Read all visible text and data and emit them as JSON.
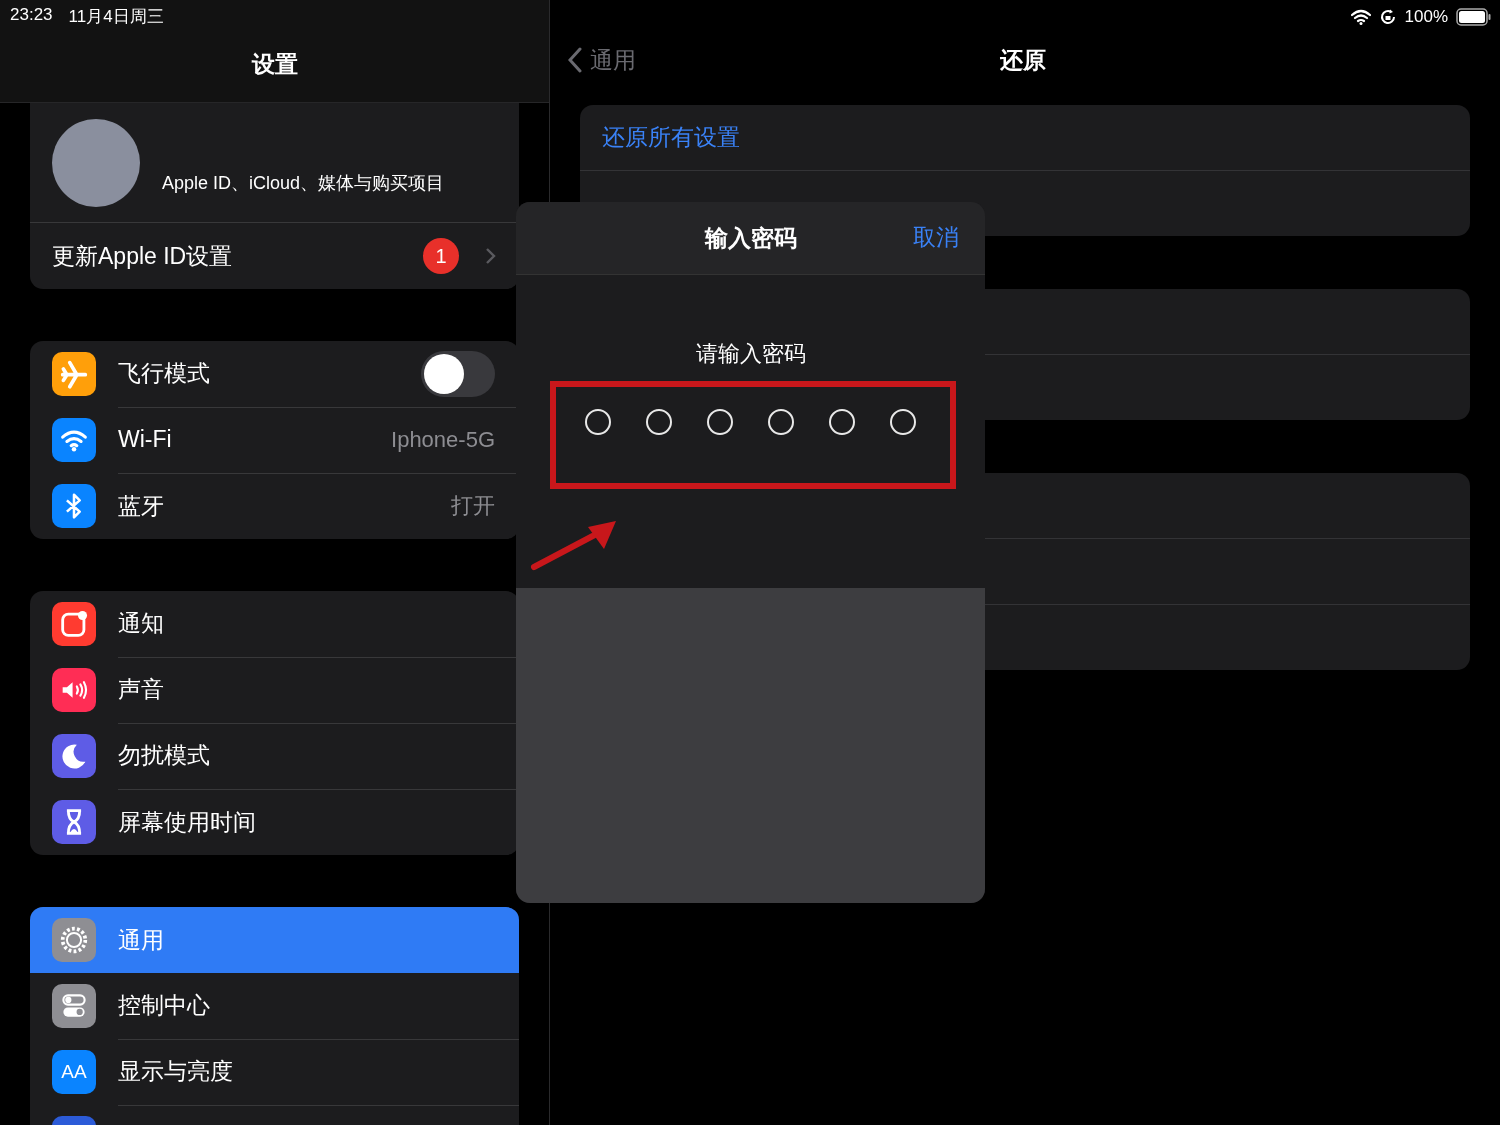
{
  "status_bar": {
    "time": "23:23",
    "date": "11月4日周三",
    "battery": "100%"
  },
  "sidebar": {
    "title": "设置",
    "profile": {
      "subtitle": "Apple ID、iCloud、媒体与购买项目",
      "update_label": "更新Apple ID设置",
      "badge": "1"
    },
    "groups": [
      {
        "items": [
          {
            "kind": "toggle",
            "color": "#ff9f0a",
            "label": "飞行模式",
            "on": false,
            "selected": false
          },
          {
            "kind": "value",
            "color": "#0a84ff",
            "label": "Wi-Fi",
            "value": "Iphone-5G",
            "selected": false
          },
          {
            "kind": "value",
            "color": "#0a84ff",
            "label": "蓝牙",
            "value": "打开",
            "selected": false
          }
        ]
      },
      {
        "items": [
          {
            "kind": "plain",
            "color": "#ff3b30",
            "label": "通知",
            "selected": false
          },
          {
            "kind": "plain",
            "color": "#ff2d55",
            "label": "声音",
            "selected": false
          },
          {
            "kind": "plain",
            "color": "#5e5ce6",
            "label": "勿扰模式",
            "selected": false
          },
          {
            "kind": "plain",
            "color": "#5e5ce6",
            "label": "屏幕使用时间",
            "selected": false
          }
        ]
      },
      {
        "items": [
          {
            "kind": "plain",
            "color": "#8e8e93",
            "label": "通用",
            "selected": true
          },
          {
            "kind": "plain",
            "color": "#8e8e93",
            "label": "控制中心",
            "selected": false
          },
          {
            "kind": "plain",
            "icon_text": "AA",
            "color": "#0a84ff",
            "label": "显示与亮度",
            "selected": false
          },
          {
            "kind": "plain",
            "color": "#2c5bd8",
            "selected": false
          }
        ]
      }
    ]
  },
  "detail": {
    "back": "通用",
    "title": "还原",
    "first_action": "还原所有设置"
  },
  "passcode_sheet": {
    "title": "输入密码",
    "cancel": "取消",
    "prompt": "请输入密码",
    "digits": [
      {
        "filled": false
      },
      {
        "filled": false
      },
      {
        "filled": false
      },
      {
        "filled": false
      },
      {
        "filled": false
      },
      {
        "filled": false
      }
    ]
  }
}
